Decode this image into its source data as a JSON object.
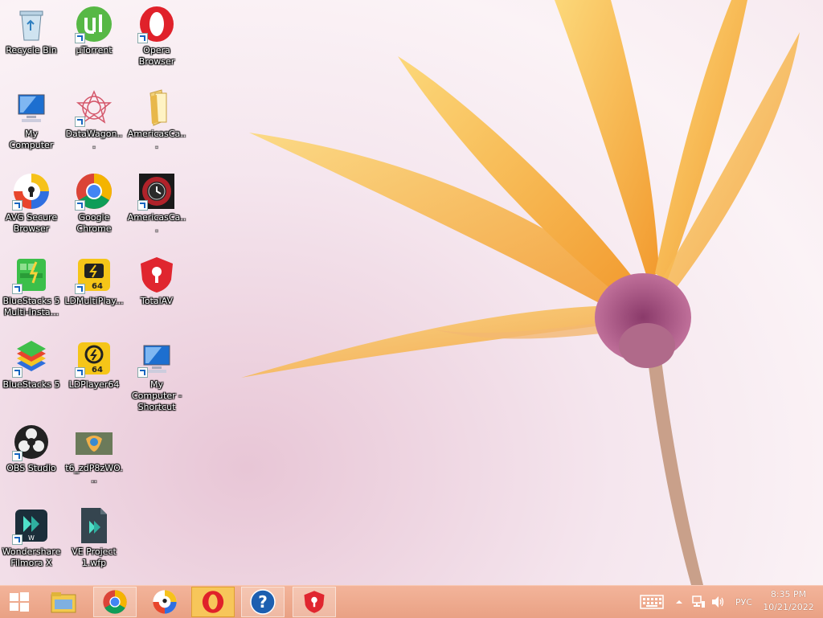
{
  "desktop": {
    "icons": [
      {
        "label": "Recycle Bin"
      },
      {
        "label": "µTorrent"
      },
      {
        "label": "Opera Browser"
      },
      {
        "label": "My Computer"
      },
      {
        "label": "DataWagon..."
      },
      {
        "label": "AmericasCa..."
      },
      {
        "label": "AVG Secure Browser"
      },
      {
        "label": "Google Chrome"
      },
      {
        "label": "AmericasCa..."
      },
      {
        "label": "BlueStacks 5 Multi-Insta..."
      },
      {
        "label": "LDMultiPlay..."
      },
      {
        "label": "TotalAV"
      },
      {
        "label": "BlueStacks 5"
      },
      {
        "label": "LDPlayer64"
      },
      {
        "label": "My Computer - Shortcut"
      },
      {
        "label": "OBS Studio"
      },
      {
        "label": "t6_zdP8zWO..."
      },
      {
        "label": "Wondershare Filmora X"
      },
      {
        "label": "VE Project 1.wfp"
      }
    ]
  },
  "taskbar": {
    "language": "РУС",
    "time": "8:35 PM",
    "date": "10/21/2022"
  },
  "colors": {
    "taskbar": "#e9a184",
    "wallpaper_bg": "#f5e6ee",
    "petal": "#f7a93b"
  }
}
